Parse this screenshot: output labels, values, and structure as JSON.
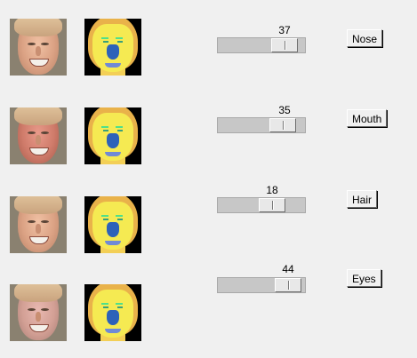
{
  "rows": [
    {
      "value": "37",
      "slider_level_percent": 37,
      "button_label": "Nose"
    },
    {
      "value": "35",
      "slider_level_percent": 35,
      "button_label": "Mouth"
    },
    {
      "value": "18",
      "slider_level_percent": 18,
      "button_label": "Hair"
    },
    {
      "value": "44",
      "slider_level_percent": 44,
      "button_label": "Eyes"
    }
  ],
  "colors": {
    "background": "#f0f0f0",
    "segmentation_hair": "#e9b24a",
    "segmentation_skin": "#f5ea52",
    "segmentation_nose": "#2d62b9",
    "segmentation_brows": "#4fe08a"
  }
}
